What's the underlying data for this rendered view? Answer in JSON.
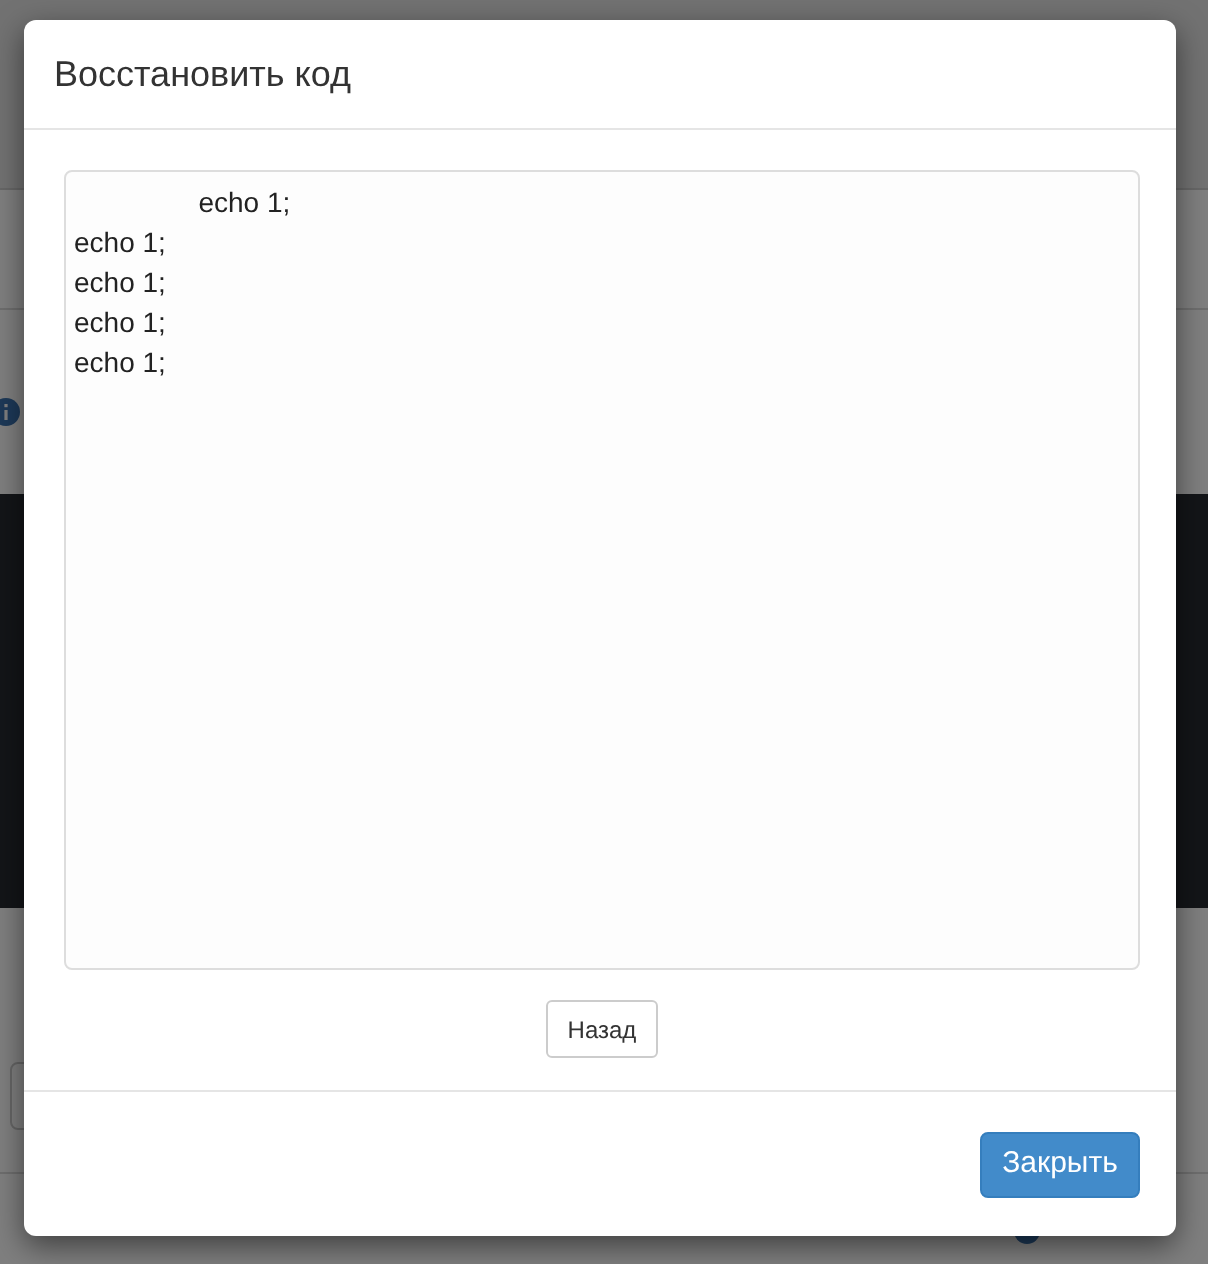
{
  "dialog": {
    "title": "Восстановить код",
    "code_field": {
      "value": "\t\techo 1;\necho 1;\necho 1;\necho 1;\necho 1;"
    },
    "back_button": "Назад",
    "close_button": "Закрыть"
  }
}
